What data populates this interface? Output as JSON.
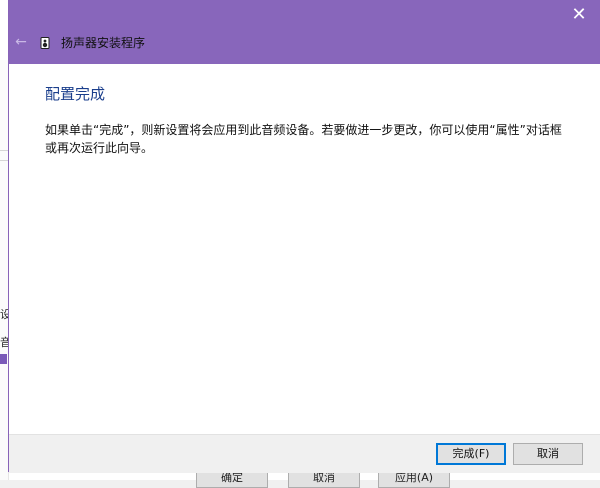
{
  "dialog": {
    "title": "扬声器安装程序",
    "close_glyph": "✕",
    "back_glyph": "←",
    "heading": "配置完成",
    "description": "如果单击“完成”，则新设置将会应用到此音频设备。若要做进一步更改，你可以使用“属性”对话框或再次运行此向导。",
    "finish_label": "完成(F)",
    "cancel_label": "取消"
  },
  "background": {
    "left_chars": [
      "设",
      "音"
    ],
    "bottom_buttons": [
      "确定",
      "取消",
      "应用(A)"
    ]
  },
  "colors": {
    "titlebar": "#8866bb",
    "heading": "#1a3e8c",
    "default_button_border": "#0078d7"
  },
  "icons": {
    "app": "speaker-icon",
    "close": "close-icon",
    "back": "back-arrow-icon"
  }
}
